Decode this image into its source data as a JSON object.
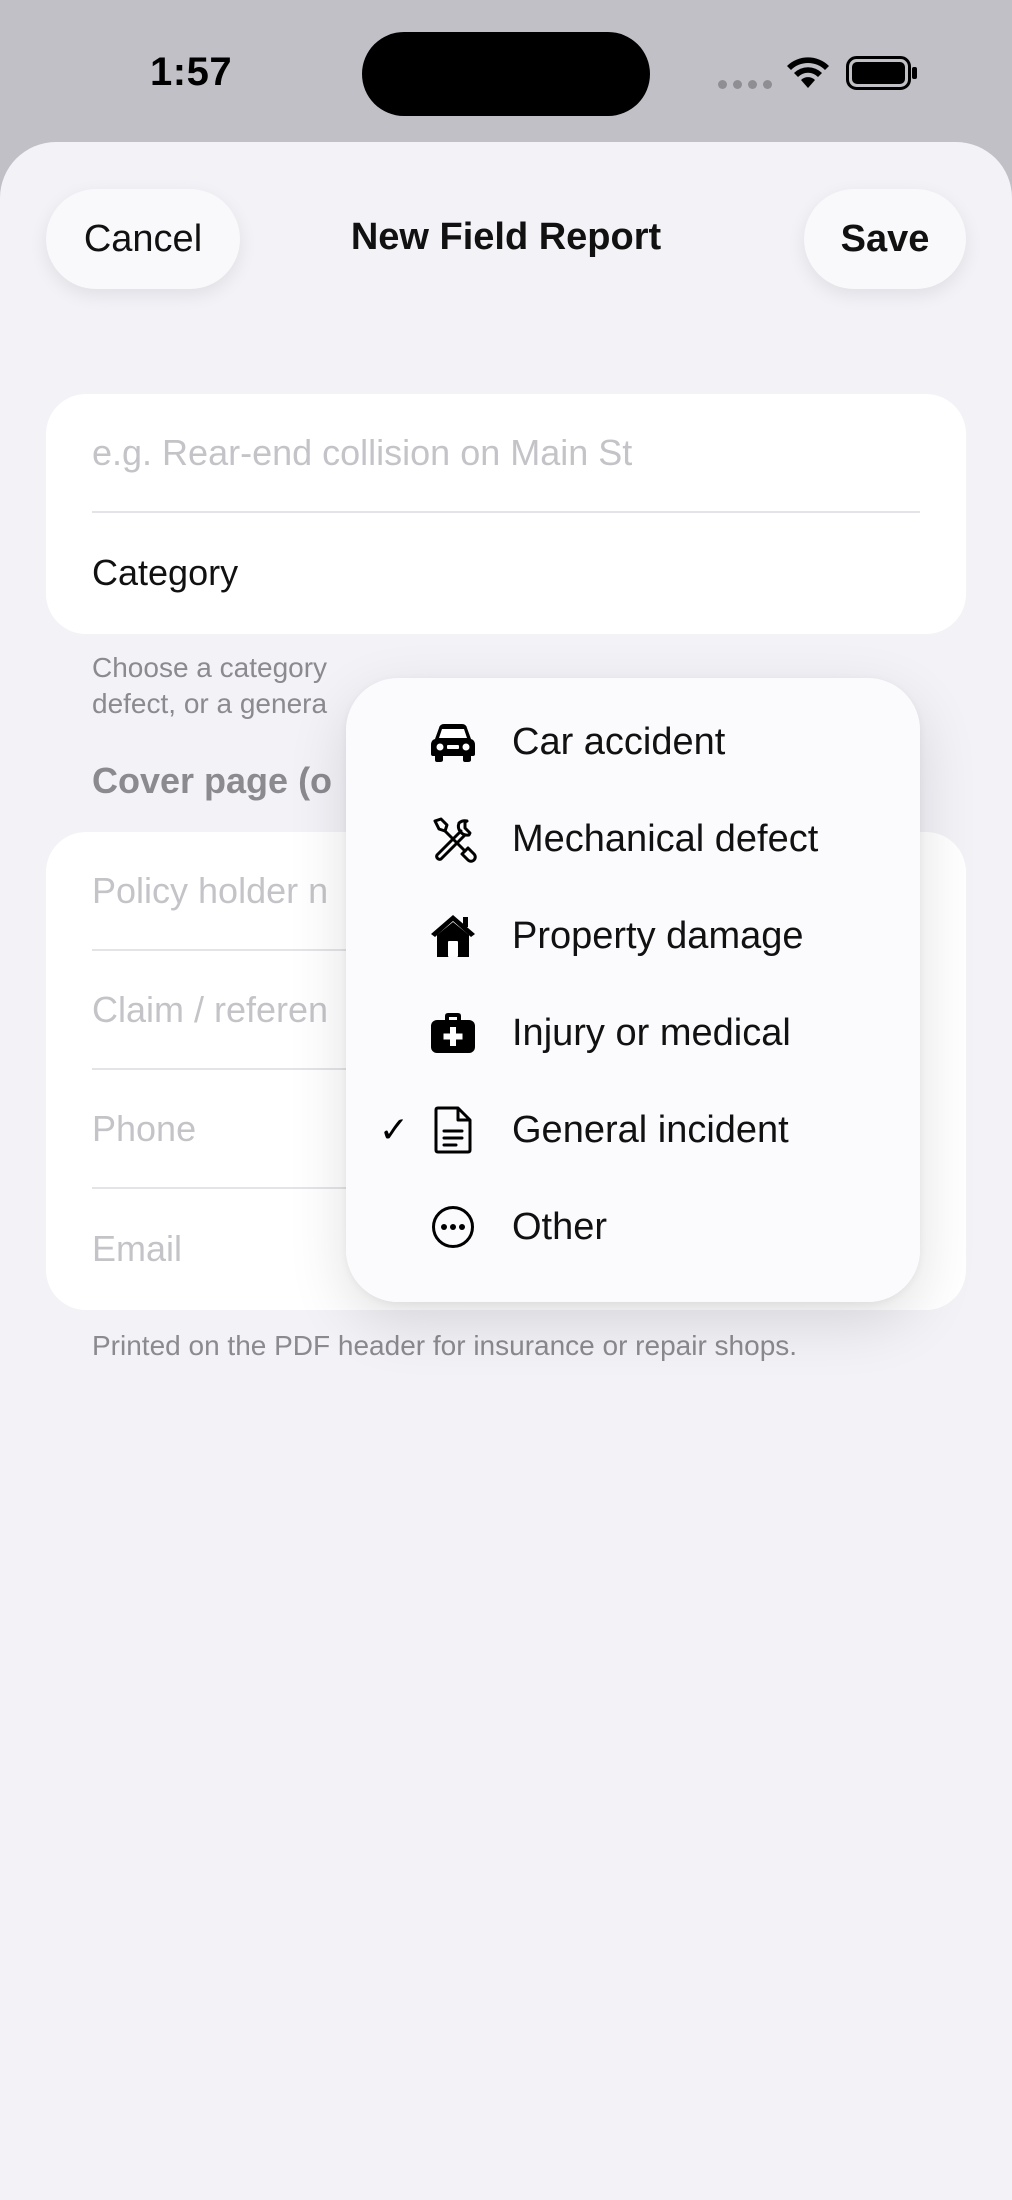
{
  "status_bar": {
    "time": "1:57"
  },
  "nav": {
    "cancel_label": "Cancel",
    "title": "New Field Report",
    "save_label": "Save"
  },
  "basic_section": {
    "title_placeholder": "e.g. Rear-end collision on Main St",
    "category_label": "Category",
    "footnote_visible": "Choose a category\ndefect, or a genera"
  },
  "cover_section": {
    "header_visible": "Cover page (o",
    "fields": [
      {
        "placeholder": "Policy holder n"
      },
      {
        "placeholder": "Claim / referen"
      },
      {
        "placeholder": "Phone"
      },
      {
        "placeholder": "Email"
      }
    ],
    "footnote": "Printed on the PDF header for insurance or repair shops."
  },
  "category_menu": {
    "items": [
      {
        "label": "Car accident",
        "icon": "car-icon",
        "selected": false
      },
      {
        "label": "Mechanical defect",
        "icon": "wrench-screwdriver-icon",
        "selected": false
      },
      {
        "label": "Property damage",
        "icon": "house-icon",
        "selected": false
      },
      {
        "label": "Injury or medical",
        "icon": "medical-kit-icon",
        "selected": false
      },
      {
        "label": "General incident",
        "icon": "document-icon",
        "selected": true
      },
      {
        "label": "Other",
        "icon": "ellipsis-circle-icon",
        "selected": false
      }
    ],
    "checkmark": "✓"
  }
}
